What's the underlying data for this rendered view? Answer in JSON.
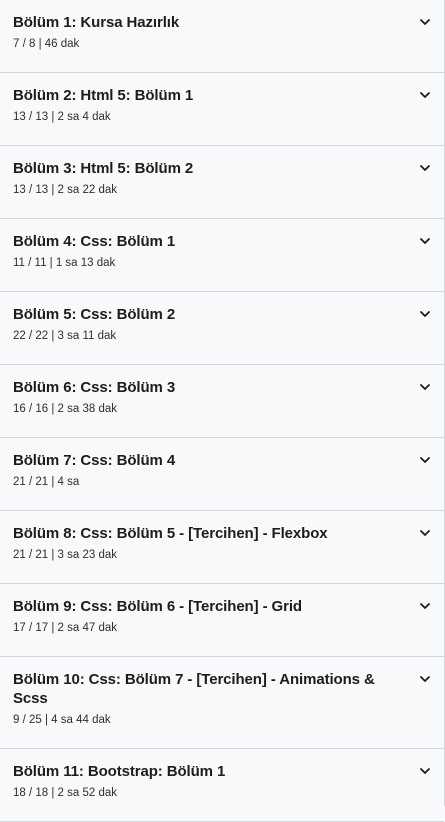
{
  "sections": [
    {
      "title": "Bölüm 1: Kursa Hazırlık",
      "meta": "7 / 8 | 46 dak",
      "icon": "chevron-down-icon"
    },
    {
      "title": "Bölüm 2: Html 5: Bölüm 1",
      "meta": "13 / 13 | 2 sa 4 dak",
      "icon": "chevron-down-icon"
    },
    {
      "title": "Bölüm 3: Html 5: Bölüm 2",
      "meta": "13 / 13 | 2 sa 22 dak",
      "icon": "chevron-down-icon"
    },
    {
      "title": "Bölüm 4: Css: Bölüm 1",
      "meta": "11 / 11 | 1 sa 13 dak",
      "icon": "chevron-down-icon"
    },
    {
      "title": "Bölüm 5: Css: Bölüm 2",
      "meta": "22 / 22 | 3 sa 11 dak",
      "icon": "chevron-down-icon"
    },
    {
      "title": "Bölüm 6: Css: Bölüm 3",
      "meta": "16 / 16 | 2 sa 38 dak",
      "icon": "chevron-down-icon"
    },
    {
      "title": "Bölüm 7: Css: Bölüm 4",
      "meta": "21 / 21 | 4 sa",
      "icon": "chevron-down-icon"
    },
    {
      "title": "Bölüm 8: Css: Bölüm 5 - [Tercihen] - Flexbox",
      "meta": "21 / 21 | 3 sa 23 dak",
      "icon": "chevron-down-icon"
    },
    {
      "title": "Bölüm 9: Css: Bölüm 6 - [Tercihen] - Grid",
      "meta": "17 / 17 | 2 sa 47 dak",
      "icon": "chevron-down-icon"
    },
    {
      "title": "Bölüm 10: Css: Bölüm 7 - [Tercihen] - Animations & Scss",
      "meta": "9 / 25 | 4 sa 44 dak",
      "icon": "chevron-down-icon"
    },
    {
      "title": "Bölüm 11: Bootstrap: Bölüm 1",
      "meta": "18 / 18 | 2 sa 52 dak",
      "icon": "chevron-down-icon"
    }
  ],
  "colors": {
    "background": "#f7f9fa",
    "text": "#1c1d1f",
    "divider": "#d1d7dc"
  }
}
